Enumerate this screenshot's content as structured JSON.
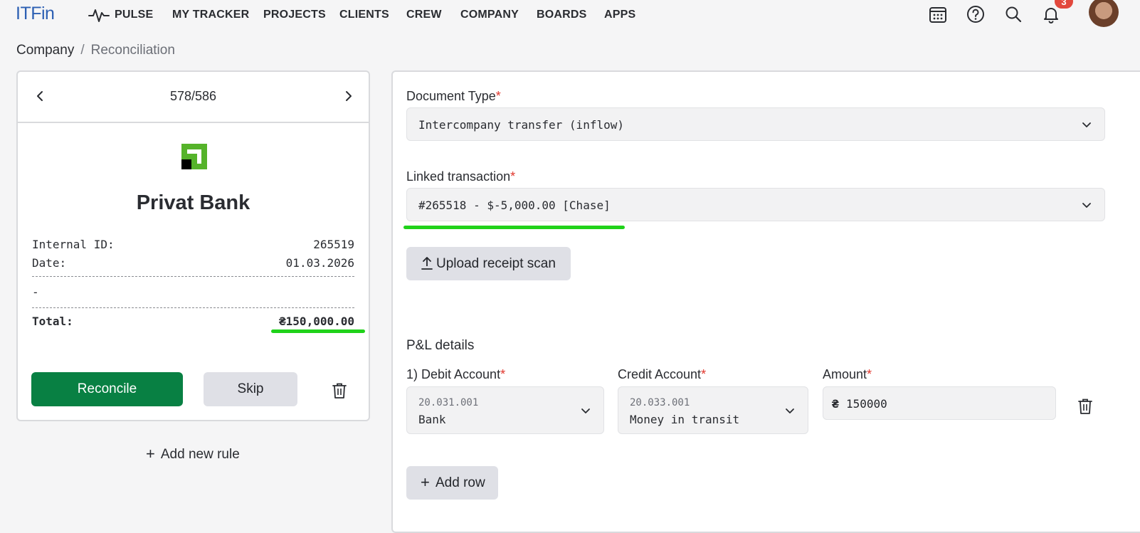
{
  "app": {
    "logo": "ITFin",
    "nav": [
      "PULSE",
      "MY TRACKER",
      "PROJECTS",
      "CLIENTS",
      "CREW",
      "COMPANY",
      "BOARDS",
      "APPS"
    ],
    "notification_count": "3",
    "icons": [
      "calendar-icon",
      "help-icon",
      "search-icon",
      "bell-icon"
    ]
  },
  "breadcrumb": {
    "parent": "Company",
    "separator": "/",
    "current": "Reconciliation"
  },
  "left_card": {
    "pager": "578/586",
    "bank_name": "Privat Bank",
    "bank_logo_colors": {
      "primary": "#55b32a",
      "accent": "#000000"
    },
    "internal_id_label": "Internal ID:",
    "internal_id": "265519",
    "date_label": "Date:",
    "date": "01.03.2026",
    "description": "-",
    "total_label": "Total:",
    "total": "₴150,000.00",
    "reconcile_label": "Reconcile",
    "skip_label": "Skip",
    "add_rule_label": "Add new rule"
  },
  "form": {
    "document_type_label": "Document Type",
    "document_type_value": "Intercompany transfer (inflow)",
    "linked_label": "Linked transaction",
    "linked_value": "#265518 - $-5,000.00 [Chase]",
    "upload_label": "Upload receipt scan",
    "pl_title": "P&L details",
    "debit_label": "1) Debit Account",
    "debit_code": "20.031.001",
    "debit_name": "Bank",
    "credit_label": "Credit Account",
    "credit_code": "20.033.001",
    "credit_name": "Money in transit",
    "amount_label": "Amount",
    "currency_symbol": "₴",
    "amount_value": "150000",
    "add_row_label": "Add row",
    "required_mark": "*"
  },
  "colors": {
    "brand": "#2c5fb3",
    "primary_button": "#088043",
    "required": "#e0362c",
    "highlight_underline": "#20d21a",
    "badge": "#e2483d"
  }
}
